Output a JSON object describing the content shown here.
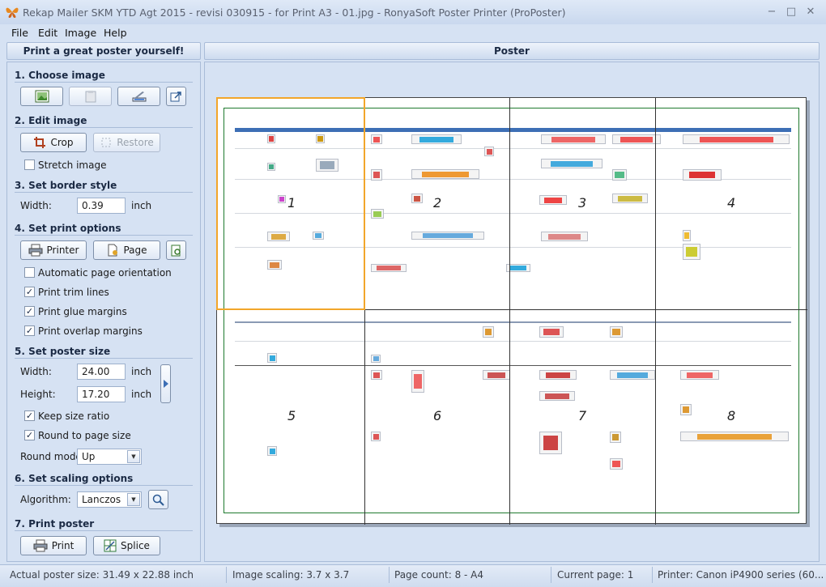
{
  "window": {
    "title": "Rekap Mailer SKM YTD Agt 2015 - revisi 030915 - for Print A3  - 01.jpg - RonyaSoft Poster Printer (ProPoster)",
    "minimize": "−",
    "maximize": "□",
    "close": "✕"
  },
  "menu": [
    "File",
    "Edit",
    "Image",
    "Help"
  ],
  "left_header": "Print a great poster yourself!",
  "right_header": "Poster",
  "sections": {
    "choose_image": "1. Choose image",
    "edit_image": "2. Edit image",
    "border_style": "3. Set border style",
    "print_options": "4. Set print options",
    "poster_size": "5. Set poster size",
    "scaling": "6. Set scaling options",
    "print_poster": "7. Print poster"
  },
  "buttons": {
    "crop": "Crop",
    "restore": "Restore",
    "printer": "Printer",
    "page": "Page",
    "print": "Print",
    "splice": "Splice"
  },
  "checkboxes": {
    "stretch": {
      "label": "Stretch image",
      "checked": false
    },
    "auto_orient": {
      "label": "Automatic page orientation",
      "checked": false
    },
    "trim": {
      "label": "Print trim lines",
      "checked": true
    },
    "glue": {
      "label": "Print glue margins",
      "checked": true
    },
    "overlap": {
      "label": "Print overlap margins",
      "checked": true
    },
    "keep_ratio": {
      "label": "Keep size ratio",
      "checked": true
    },
    "round_page": {
      "label": "Round to page size",
      "checked": true
    }
  },
  "border": {
    "label": "Width:",
    "value": "0.39",
    "unit": "inch"
  },
  "poster_size": {
    "width_label": "Width:",
    "width": "24.00",
    "height_label": "Height:",
    "height": "17.20",
    "unit": "inch",
    "round_mode_label": "Round mode:",
    "round_mode": "Up"
  },
  "scaling": {
    "algorithm_label": "Algorithm:",
    "algorithm": "Lanczos"
  },
  "poster": {
    "pages": [
      "1",
      "2",
      "3",
      "4",
      "5",
      "6",
      "7",
      "8"
    ],
    "selected_page": "1"
  },
  "status": {
    "actual": "Actual poster size: 31.49 x 22.88 inch",
    "scaling": "Image scaling: 3.7 x 3.7",
    "pages": "Page count: 8 - A4",
    "current": "Current page: 1",
    "printer": "Printer: Canon iP4900 series (60..."
  },
  "colors": {
    "selection": "#f2a62a",
    "trim": "#1f7a2e",
    "accent_bar": "#3d6fb5"
  },
  "icons": {
    "app": "butterfly-icon",
    "open": "open-image-icon",
    "paste": "paste-icon",
    "scan": "scanner-icon",
    "export": "export-icon",
    "crop": "crop-icon",
    "restore": "restore-icon",
    "printer": "printer-icon",
    "page": "page-setup-icon",
    "preview": "print-preview-icon",
    "expand": "chevron-right-icon",
    "zoom": "magnifier-icon",
    "print": "print-icon",
    "splice": "splice-icon"
  }
}
